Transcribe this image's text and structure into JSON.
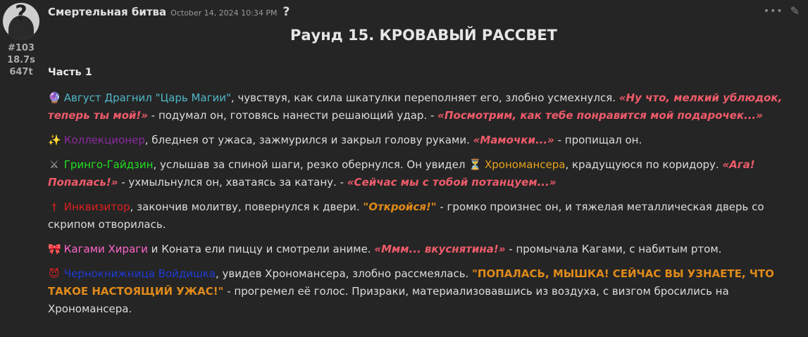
{
  "post": {
    "author": "Смертельная битва",
    "date": "October 14, 2024 10:34 PM",
    "help": "?",
    "stats": [
      "#103",
      "18.7s",
      "647t"
    ],
    "title": "Раунд 15. КРОВАВЫЙ РАССВЕТ",
    "part": "Часть 1"
  },
  "colors": {
    "avgust": "#4fb8c8",
    "kollekcioner": "#8a2a9e",
    "gringo": "#21e021",
    "hronomanser": "#e6a31a",
    "inkvizitor": "#e02020",
    "kagami": "#ff66cc",
    "necro": "#1f3bd6",
    "quote_red": "#ef5b6a",
    "quote_orange": "#e08a1a",
    "text": "#dcdcdc"
  },
  "paragraphs": [
    {
      "icon": "crystal-ball-icon",
      "glyph": "🔮",
      "name": "Август Драгнил \"Царь Магии\"",
      "t1": ", чувствуя, как сила шкатулки переполняет его, злобно усмехнулся. ",
      "q1": "«Ну что, мелкий ублюдок, теперь ты мой!»",
      "t2": " - подумал он, готовясь нанести решающий удар. - ",
      "q2": "«Посмотрим, как тебе понравится мой подарочек...»"
    },
    {
      "icon": "sparkles-icon",
      "glyph": "✨",
      "name": "Коллекционер",
      "t1": ", бледнея от ужаса, зажмурился и закрыл голову руками. ",
      "q1": "«Мамочки...»",
      "t2": " - пропищал он."
    },
    {
      "icon": "crossed-swords-icon",
      "glyph": "⚔",
      "name": "Гринго-Гайдзин",
      "t1": ", услышав за спиной шаги, резко обернулся. Он увидел ",
      "icon2": "hourglass-icon",
      "glyph2": "⏳",
      "name2": "Хрономансера",
      "t2": ", крадущуюся по коридору. ",
      "q1": "«Ага! Попалась!»",
      "t3": " - ухмыльнулся он, хватаясь за катану. - ",
      "q2": "«Сейчас мы с тобой потанцуем...»"
    },
    {
      "icon": "dagger-cross-icon",
      "glyph": "†",
      "name": "Инквизитор",
      "t1": ", закончив молитву, повернулся к двери. ",
      "q1": "\"Откройся!\"",
      "t2": " - громко произнес он, и тяжелая металлическая дверь со скрипом отворилась."
    },
    {
      "icon": "ribbon-icon",
      "glyph": "🎀",
      "name": "Кагами Хираги",
      "t1": " и Коната ели пиццу и смотрели аниме. ",
      "q1": "«Ммм... вкуснятина!»",
      "t2": " - промычала Кагами, с набитым ртом."
    },
    {
      "icon": "devil-icon",
      "glyph": "😈",
      "name": "Чернокнижница Войдишка",
      "t1": ", увидев Хрономансера, злобно рассмеялась. ",
      "q1": "\"ПОПАЛАСЬ, МЫШКА! СЕЙЧАС ВЫ УЗНАЕТЕ, ЧТО ТАКОЕ НАСТОЯЩИЙ УЖАС!\"",
      "t2": " - прогремел её голос. Призраки, материализовавшись из воздуха, с визгом бросились на Хрономансера."
    }
  ]
}
